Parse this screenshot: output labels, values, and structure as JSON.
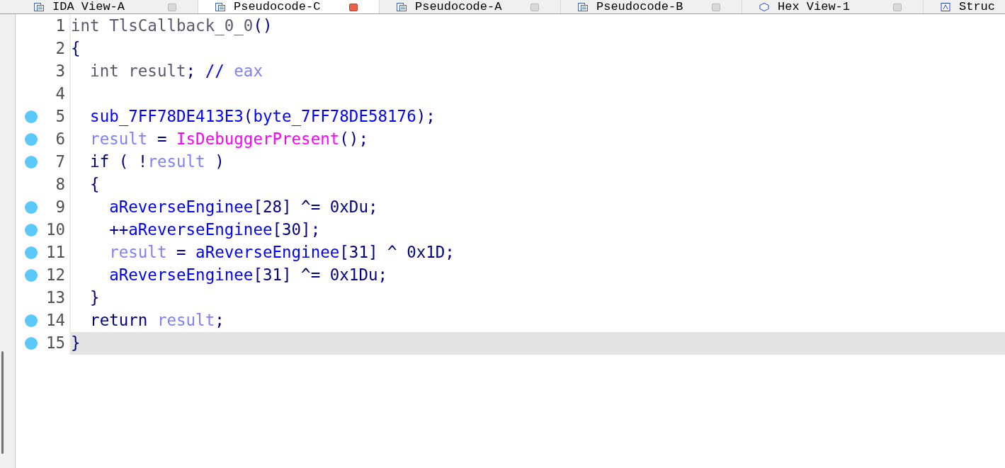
{
  "tabs": [
    {
      "label": "IDA View-A",
      "selected": false
    },
    {
      "label": "Pseudocode-C",
      "selected": true
    },
    {
      "label": "Pseudocode-A",
      "selected": false
    },
    {
      "label": "Pseudocode-B",
      "selected": false
    },
    {
      "label": "Hex View-1",
      "selected": false
    },
    {
      "label": "Struc",
      "selected": false
    }
  ],
  "lines": [
    {
      "number": "1",
      "breakpoint": false,
      "selected": false,
      "tokens": [
        {
          "kind": "decl",
          "text": "int TlsCallback_0_0"
        },
        {
          "kind": "plain",
          "text": "()"
        }
      ]
    },
    {
      "number": "2",
      "breakpoint": false,
      "selected": false,
      "tokens": [
        {
          "kind": "plain",
          "text": "{"
        }
      ]
    },
    {
      "number": "3",
      "breakpoint": false,
      "selected": false,
      "tokens": [
        {
          "kind": "decl",
          "text": "  int result"
        },
        {
          "kind": "plain",
          "text": "; "
        },
        {
          "kind": "comment",
          "text": "//"
        },
        {
          "kind": "local",
          "text": " eax"
        }
      ]
    },
    {
      "number": "4",
      "breakpoint": false,
      "selected": false
    },
    {
      "number": "5",
      "breakpoint": true,
      "selected": false,
      "tokens": [
        {
          "kind": "global",
          "text": "  sub_7FF78DE413E3"
        },
        {
          "kind": "plain",
          "text": "("
        },
        {
          "kind": "global",
          "text": "byte_7FF78DE58176"
        },
        {
          "kind": "plain",
          "text": ");"
        }
      ]
    },
    {
      "number": "6",
      "breakpoint": true,
      "selected": false,
      "tokens": [
        {
          "kind": "local",
          "text": "  result"
        },
        {
          "kind": "plain",
          "text": " = "
        },
        {
          "kind": "import",
          "text": "IsDebuggerPresent"
        },
        {
          "kind": "plain",
          "text": "();"
        }
      ]
    },
    {
      "number": "7",
      "breakpoint": true,
      "selected": false,
      "tokens": [
        {
          "kind": "plain",
          "text": "  if ( !"
        },
        {
          "kind": "local",
          "text": "result"
        },
        {
          "kind": "plain",
          "text": " )"
        }
      ]
    },
    {
      "number": "8",
      "breakpoint": false,
      "selected": false,
      "tokens": [
        {
          "kind": "plain",
          "text": "  {"
        }
      ]
    },
    {
      "number": "9",
      "breakpoint": true,
      "selected": false,
      "tokens": [
        {
          "kind": "global",
          "text": "    aReverseEnginee"
        },
        {
          "kind": "plain",
          "text": "[28] ^= 0xDu;"
        }
      ]
    },
    {
      "number": "10",
      "breakpoint": true,
      "selected": false,
      "tokens": [
        {
          "kind": "plain",
          "text": "    ++"
        },
        {
          "kind": "global",
          "text": "aReverseEnginee"
        },
        {
          "kind": "plain",
          "text": "[30];"
        }
      ]
    },
    {
      "number": "11",
      "breakpoint": true,
      "selected": false,
      "tokens": [
        {
          "kind": "local",
          "text": "    result"
        },
        {
          "kind": "plain",
          "text": " = "
        },
        {
          "kind": "global",
          "text": "aReverseEnginee"
        },
        {
          "kind": "plain",
          "text": "[31] ^ 0x1D;"
        }
      ]
    },
    {
      "number": "12",
      "breakpoint": true,
      "selected": false,
      "tokens": [
        {
          "kind": "global",
          "text": "    aReverseEnginee"
        },
        {
          "kind": "plain",
          "text": "[31] ^= 0x1Du;"
        }
      ]
    },
    {
      "number": "13",
      "breakpoint": false,
      "selected": false,
      "tokens": [
        {
          "kind": "plain",
          "text": "  }"
        }
      ]
    },
    {
      "number": "14",
      "breakpoint": true,
      "selected": false,
      "tokens": [
        {
          "kind": "plain",
          "text": "  return "
        },
        {
          "kind": "local",
          "text": "result"
        },
        {
          "kind": "plain",
          "text": ";"
        }
      ]
    },
    {
      "number": "15",
      "breakpoint": true,
      "selected": true,
      "tokens": [
        {
          "kind": "plain",
          "text": "}"
        }
      ]
    }
  ]
}
